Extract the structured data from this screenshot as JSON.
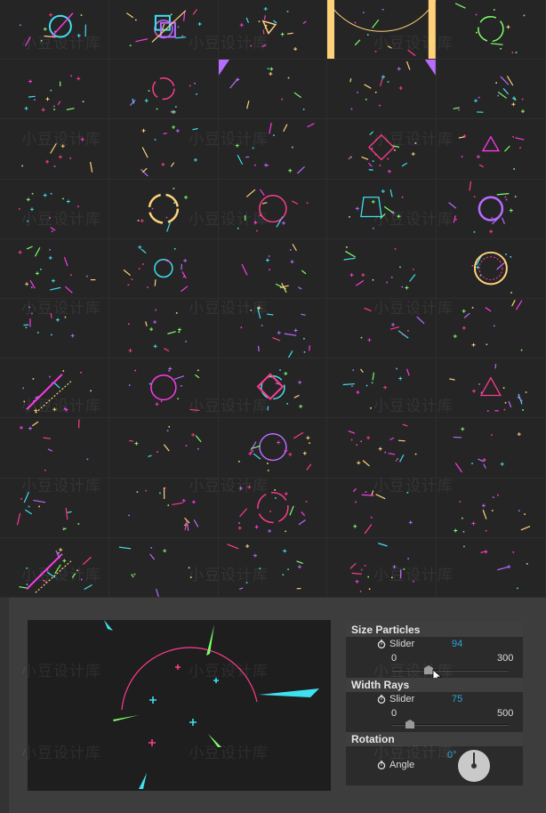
{
  "watermark": "小豆设计库",
  "colors": {
    "pink": "#ff3b8d",
    "cyan": "#3fe0f0",
    "green": "#7dff6a",
    "purple": "#b86bff",
    "yellow": "#ffd27a",
    "magenta": "#ff39e8"
  },
  "thumbnails": [
    "hud-01",
    "hud-02",
    "hud-03",
    "hud-04",
    "hud-05",
    "hud-06",
    "hud-07",
    "hud-08",
    "hud-09",
    "hud-10",
    "hud-11",
    "hud-12",
    "hud-13",
    "hud-14",
    "hud-15",
    "hud-16",
    "hud-17",
    "hud-18",
    "hud-19",
    "hud-20",
    "hud-21",
    "hud-22",
    "hud-23",
    "hud-24",
    "hud-25",
    "hud-26",
    "hud-27",
    "hud-28",
    "hud-29",
    "hud-30",
    "hud-31",
    "hud-32",
    "hud-33",
    "hud-34",
    "hud-35",
    "hud-36",
    "hud-37",
    "hud-38",
    "hud-39",
    "hud-40",
    "hud-41",
    "hud-42",
    "hud-43",
    "hud-44",
    "hud-45",
    "hud-46",
    "hud-47",
    "hud-48",
    "hud-49",
    "hud-50"
  ],
  "panel": {
    "sections": [
      {
        "title": "Size Particles",
        "control": "Slider",
        "value": "94",
        "min": "0",
        "max": "300",
        "level": 0.313
      },
      {
        "title": "Width Rays",
        "control": "Slider",
        "value": "75",
        "min": "0",
        "max": "500",
        "level": 0.15
      },
      {
        "title": "Rotation",
        "control": "Angle",
        "value": "0°"
      }
    ]
  },
  "icons": {
    "stopwatch": "stopwatch-icon",
    "cursor": "pointer-cursor-icon"
  }
}
